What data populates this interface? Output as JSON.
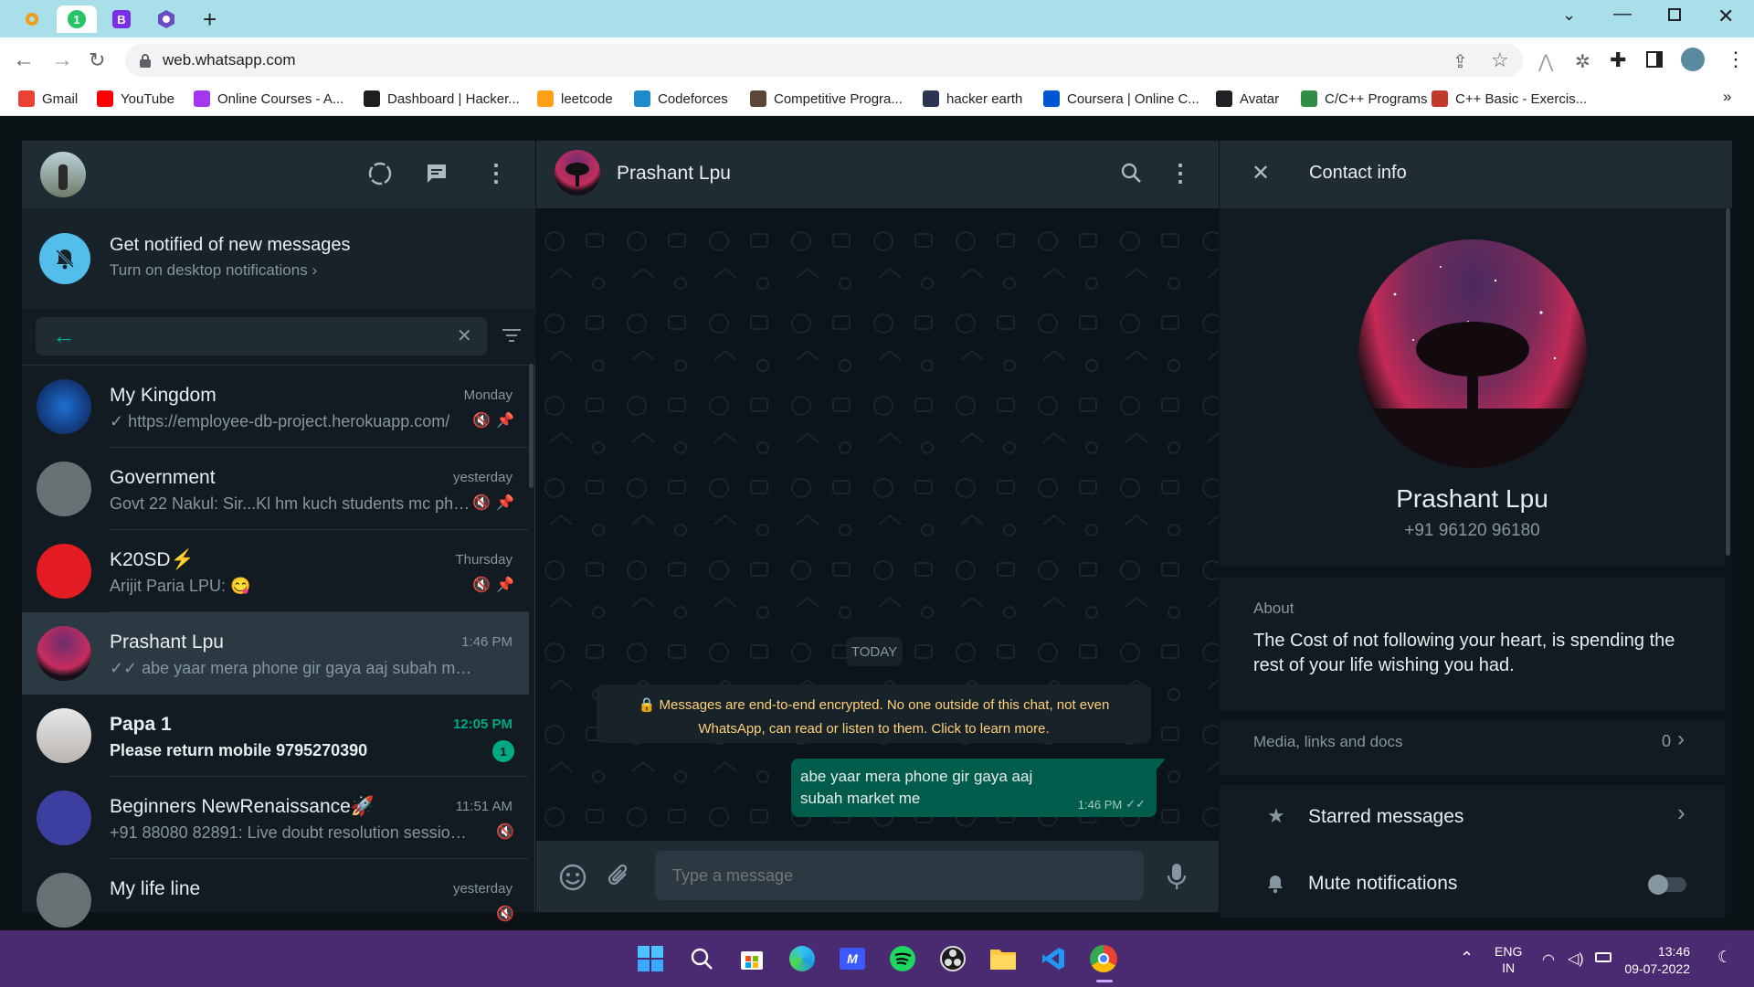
{
  "browser": {
    "url": "web.whatsapp.com",
    "tabs": [
      {
        "icon": "orange-gear-icon"
      },
      {
        "icon": "green-badge-icon",
        "badge": "1"
      },
      {
        "icon": "bootstrap-icon",
        "badge": "B"
      },
      {
        "icon": "purple-hexagon-icon"
      }
    ],
    "bookmarks": [
      {
        "label": "Gmail",
        "icon": "gmail-icon",
        "color": "#ea4335"
      },
      {
        "label": "YouTube",
        "icon": "youtube-icon",
        "color": "#ff0000"
      },
      {
        "label": "Online Courses - A...",
        "icon": "udemy-icon",
        "color": "#a435f0"
      },
      {
        "label": "Dashboard | Hacker...",
        "icon": "hackerrank-icon",
        "color": "#1e1e1e"
      },
      {
        "label": "leetcode",
        "icon": "leetcode-icon",
        "color": "#ffa116"
      },
      {
        "label": "Codeforces",
        "icon": "codeforces-icon",
        "color": "#1f8acb"
      },
      {
        "label": "Competitive Progra...",
        "icon": "codechef-icon",
        "color": "#5b4638"
      },
      {
        "label": "hacker earth",
        "icon": "hackerearth-icon",
        "color": "#2c3454"
      },
      {
        "label": "Coursera | Online C...",
        "icon": "coursera-icon",
        "color": "#0056d2"
      },
      {
        "label": "Avatar",
        "icon": "avatar-icon",
        "color": "#202124"
      },
      {
        "label": "C/C++ Programs -...",
        "icon": "gfg-icon",
        "color": "#2f8d46"
      },
      {
        "label": "C++ Basic - Exercis...",
        "icon": "w3r-icon",
        "color": "#c0392b"
      }
    ]
  },
  "sidebar": {
    "notification": {
      "title": "Get notified of new messages",
      "subtitle": "Turn on desktop notifications ›"
    },
    "search_placeholder": "",
    "chats": [
      {
        "name": "My Kingdom",
        "time": "Monday",
        "preview": "✓ https://employee-db-project.herokuapp.com/",
        "muted": true,
        "pinned": true
      },
      {
        "name": "Government",
        "time": "yesterday",
        "preview": "Govt 22 Nakul: Sir...Kl hm kuch students mc pha...",
        "muted": true,
        "pinned": true
      },
      {
        "name": "K20SD⚡",
        "time": "Thursday",
        "preview": "Arijit Paria LPU: 😋",
        "muted": true,
        "pinned": true
      },
      {
        "name": "Prashant Lpu",
        "time": "1:46 PM",
        "preview": "✓✓ abe yaar mera phone gir gaya  aaj subah market me",
        "selected": true
      },
      {
        "name": "Papa 1",
        "time": "12:05 PM",
        "preview": "Please return mobile 9795270390",
        "unread": "1"
      },
      {
        "name": "Beginners NewRenaissance🚀",
        "time": "11:51 AM",
        "preview": "+91 88080 82891: Live doubt resolution session -  T...",
        "muted": true
      },
      {
        "name": "My life line",
        "time": "yesterday",
        "preview": "",
        "muted": true
      }
    ]
  },
  "conversation": {
    "contact_name": "Prashant Lpu",
    "date_chip": "TODAY",
    "encryption_notice": "🔒 Messages are end-to-end encrypted. No one outside of this chat, not even WhatsApp, can read or listen to them. Click to learn more.",
    "messages": [
      {
        "text": "abe yaar mera phone gir gaya  aaj subah market me",
        "time": "1:46 PM",
        "outgoing": true
      }
    ],
    "input_placeholder": "Type a message"
  },
  "contact_info": {
    "header": "Contact info",
    "name": "Prashant Lpu",
    "phone": "+91 96120 96180",
    "about_label": "About",
    "about_text": "The Cost of not following your heart, is spending the rest of your life wishing you had.",
    "media_label": "Media, links and docs",
    "media_count": "0",
    "starred_label": "Starred messages",
    "mute_label": "Mute notifications",
    "mute_on": false
  },
  "taskbar": {
    "language": "ENG",
    "region": "IN",
    "time": "13:46",
    "date": "09-07-2022"
  },
  "colors": {
    "accent_green": "#00a884",
    "outgoing_bubble": "#005c4b",
    "unread_badge": "#00a884"
  }
}
